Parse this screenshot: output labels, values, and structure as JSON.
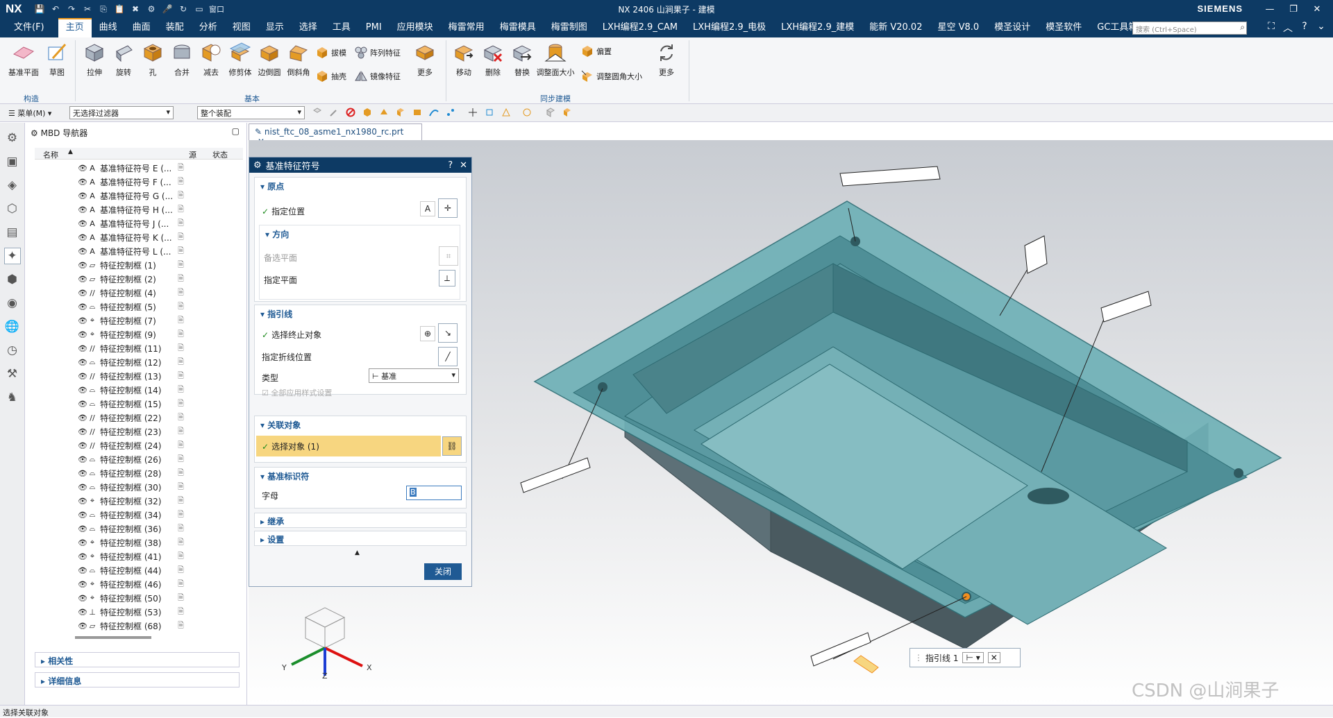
{
  "app": {
    "logo": "NX",
    "title": "NX 2406 山涧果子 - 建模",
    "brand": "SIEMENS",
    "window_menu": "窗口"
  },
  "menubar": [
    "文件(F)",
    "主页",
    "曲线",
    "曲面",
    "装配",
    "分析",
    "视图",
    "显示",
    "选择",
    "工具",
    "PMI",
    "应用模块",
    "梅雷常用",
    "梅雷模具",
    "梅雷制图",
    "LXH编程2.9_CAM",
    "LXH编程2.9_电极",
    "LXH编程2.9_建模",
    "能新 V20.02",
    "星空 V8.0",
    "模圣设计",
    "模圣软件",
    "GC工具箱"
  ],
  "search_placeholder": "搜索 (Ctrl+Space)",
  "ribbon": {
    "construct": {
      "items": [
        "基准平面",
        "草图"
      ],
      "group": "构造"
    },
    "basic": {
      "items": [
        "拉伸",
        "旋转",
        "孔",
        "合并",
        "减去",
        "修剪体",
        "边倒圆",
        "倒斜角"
      ],
      "small": [
        "拔模",
        "阵列特征",
        "抽壳",
        "镜像特征"
      ],
      "more": "更多",
      "group": "基本"
    },
    "sync": {
      "items": [
        "移动",
        "删除",
        "替换",
        "调整面大小"
      ],
      "small": [
        "偏置",
        "调整圆角大小"
      ],
      "more": "更多",
      "group": "同步建模"
    }
  },
  "toolbar2": {
    "menu": "菜单(M)",
    "filter": "无选择过滤器",
    "scope": "整个装配"
  },
  "navigator": {
    "title": "MBD 导航器",
    "cols": [
      "名称",
      "源",
      "状态"
    ],
    "rows": [
      {
        "sym": "A",
        "label": "基准特征符号 E (..."
      },
      {
        "sym": "A",
        "label": "基准特征符号 F (..."
      },
      {
        "sym": "A",
        "label": "基准特征符号 G (..."
      },
      {
        "sym": "A",
        "label": "基准特征符号 H (..."
      },
      {
        "sym": "A",
        "label": "基准特征符号 J (..."
      },
      {
        "sym": "A",
        "label": "基准特征符号 K (..."
      },
      {
        "sym": "A",
        "label": "基准特征符号 L (..."
      },
      {
        "sym": "▱",
        "label": "特征控制框 (1)"
      },
      {
        "sym": "▱",
        "label": "特征控制框 (2)"
      },
      {
        "sym": "//",
        "label": "特征控制框 (4)"
      },
      {
        "sym": "⌓",
        "label": "特征控制框 (5)"
      },
      {
        "sym": "⌖",
        "label": "特征控制框 (7)"
      },
      {
        "sym": "⌖",
        "label": "特征控制框 (9)"
      },
      {
        "sym": "//",
        "label": "特征控制框 (11)"
      },
      {
        "sym": "⌓",
        "label": "特征控制框 (12)"
      },
      {
        "sym": "//",
        "label": "特征控制框 (13)"
      },
      {
        "sym": "⌓",
        "label": "特征控制框 (14)"
      },
      {
        "sym": "⌓",
        "label": "特征控制框 (15)"
      },
      {
        "sym": "//",
        "label": "特征控制框 (22)"
      },
      {
        "sym": "//",
        "label": "特征控制框 (23)"
      },
      {
        "sym": "//",
        "label": "特征控制框 (24)"
      },
      {
        "sym": "⌓",
        "label": "特征控制框 (26)"
      },
      {
        "sym": "⌓",
        "label": "特征控制框 (28)"
      },
      {
        "sym": "⌓",
        "label": "特征控制框 (30)"
      },
      {
        "sym": "⌖",
        "label": "特征控制框 (32)"
      },
      {
        "sym": "⌓",
        "label": "特征控制框 (34)"
      },
      {
        "sym": "⌓",
        "label": "特征控制框 (36)"
      },
      {
        "sym": "⌖",
        "label": "特征控制框 (38)"
      },
      {
        "sym": "⌖",
        "label": "特征控制框 (41)"
      },
      {
        "sym": "⌓",
        "label": "特征控制框 (44)"
      },
      {
        "sym": "⌖",
        "label": "特征控制框 (46)"
      },
      {
        "sym": "⌖",
        "label": "特征控制框 (50)"
      },
      {
        "sym": "⊥",
        "label": "特征控制框 (53)"
      },
      {
        "sym": "▱",
        "label": "特征控制框 (68)"
      }
    ],
    "sections": [
      "相关性",
      "详细信息"
    ]
  },
  "doc_tab": "nist_ftc_08_asme1_nx1980_rc.prt",
  "dialog": {
    "title": "基准特征符号",
    "origin": {
      "header": "原点",
      "specify_location": "指定位置",
      "direction_header": "方向",
      "alt_plane": "备选平面",
      "specify_plane": "指定平面"
    },
    "leader": {
      "header": "指引线",
      "select_terminator": "选择终止对象",
      "specify_jog": "指定折线位置",
      "type_label": "类型",
      "type_value": "基准",
      "apply_all": "全部应用样式设置"
    },
    "assoc": {
      "header": "关联对象",
      "select_object": "选择对象 (1)"
    },
    "identifier": {
      "header": "基准标识符",
      "letter_label": "字母",
      "letter_value": "B"
    },
    "inherit": "继承",
    "settings": "设置",
    "close": "关闭"
  },
  "mini_toolbar": {
    "label": "指引线 1"
  },
  "status": "选择关联对象",
  "watermark": "CSDN @山涧果子",
  "triad": {
    "x": "X",
    "y": "Y",
    "z": "Z"
  },
  "colors": {
    "dark_blue": "#0d3a64",
    "accent": "#f29c1f",
    "part": "#5a9ea6",
    "highlight": "#f7d680"
  }
}
